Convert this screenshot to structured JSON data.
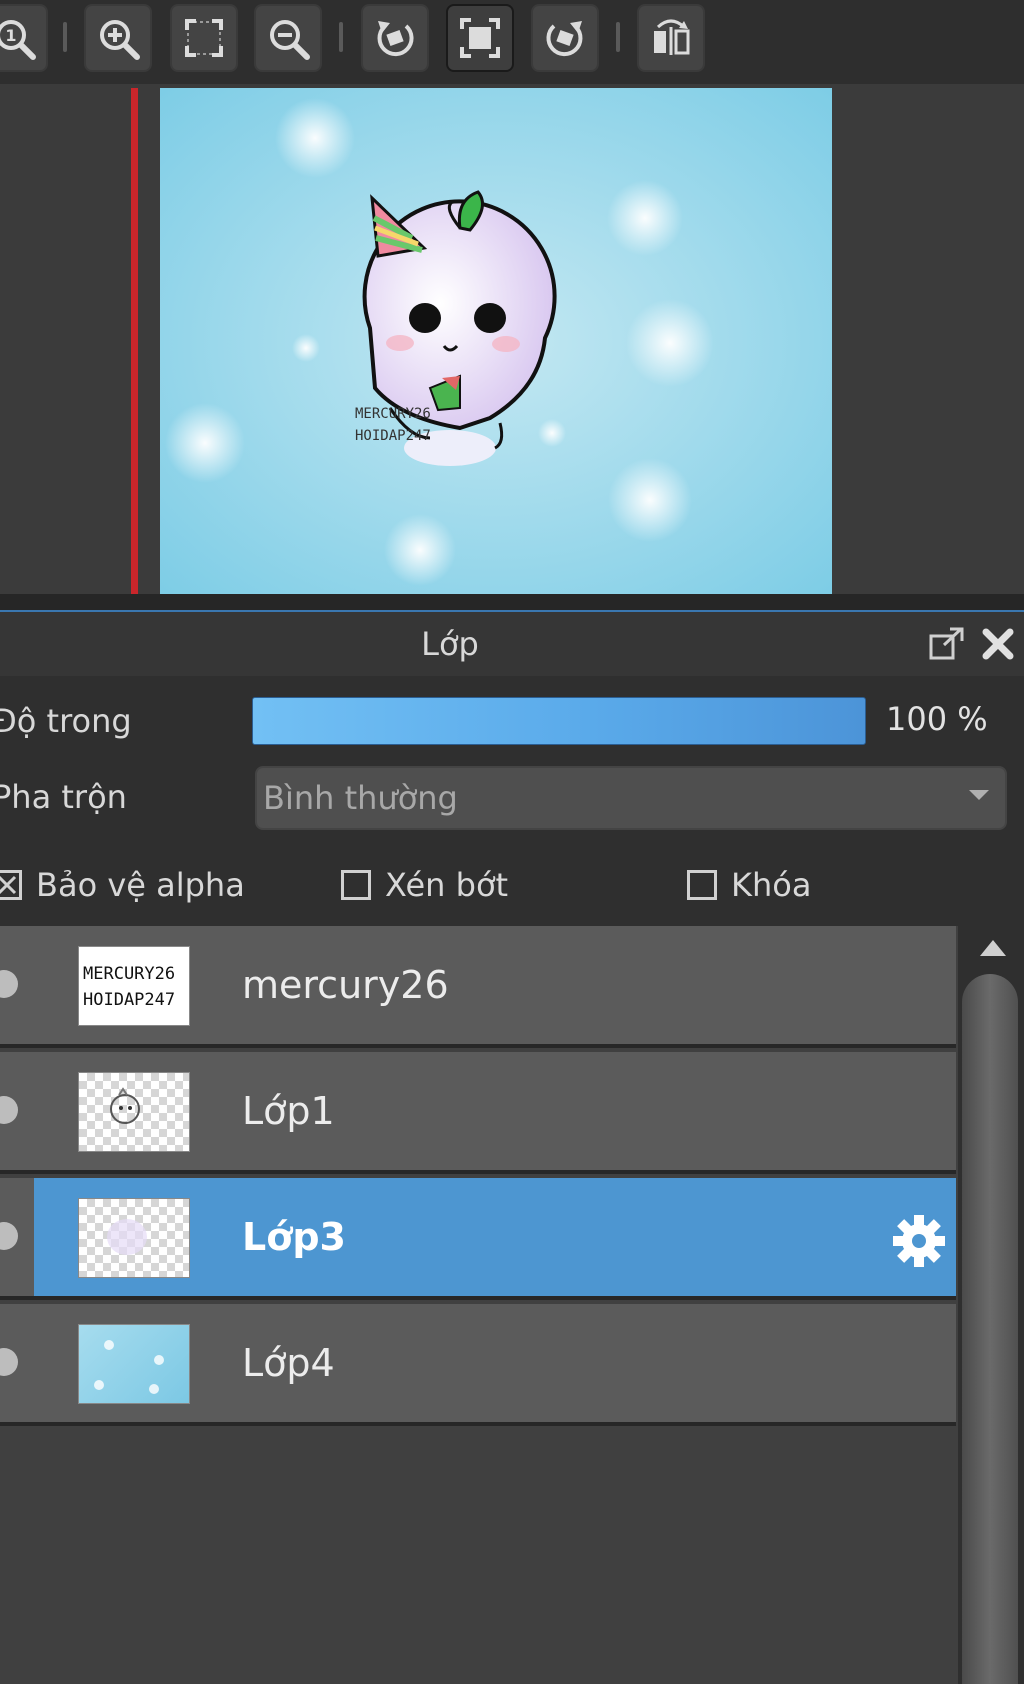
{
  "toolbar": {
    "buttons": [
      {
        "icon": "zoom-actual-size-icon"
      },
      {
        "icon": "zoom-in-icon"
      },
      {
        "icon": "fit-to-window-icon"
      },
      {
        "icon": "zoom-out-icon"
      },
      {
        "icon": "rotate-left-icon"
      },
      {
        "icon": "full-screen-icon",
        "active": true
      },
      {
        "icon": "rotate-right-icon"
      },
      {
        "icon": "flip-horizontal-icon"
      }
    ]
  },
  "canvas": {
    "artwork_text_line1": "MERCURY26",
    "artwork_text_line2": "HOIDAP247",
    "background_color": "#8fd0e6",
    "guide_color": "#c9262b"
  },
  "layer_panel": {
    "title": "Lớp",
    "opacity_label": "Độ trong",
    "opacity_percent": 100,
    "opacity_value": "100 %",
    "blend_label": "Pha trộn",
    "blend_value": "Bình thường",
    "checkboxes": {
      "protect_alpha": {
        "label": "Bảo vệ alpha",
        "checked": true
      },
      "clipping": {
        "label": "Xén bớt",
        "checked": false
      },
      "lock": {
        "label": "Khóa",
        "checked": false
      }
    },
    "layers": [
      {
        "name": "mercury26",
        "selected": false,
        "thumb_text1": "MERCURY26",
        "thumb_text2": "HOIDAP247"
      },
      {
        "name": "Lớp1",
        "selected": false
      },
      {
        "name": "Lớp3",
        "selected": true
      },
      {
        "name": "Lớp4",
        "selected": false
      }
    ],
    "accent_color": "#4d96d1"
  }
}
